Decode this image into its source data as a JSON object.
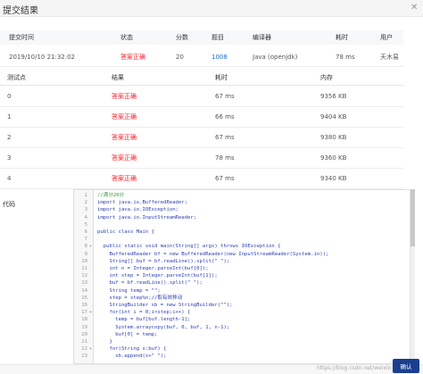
{
  "dialog": {
    "title": "提交结果",
    "close_symbol": "✕"
  },
  "summary": {
    "headers": [
      "提交时间",
      "状态",
      "分数",
      "题目",
      "编译器",
      "耗时",
      "用户"
    ],
    "row": {
      "time": "2019/10/10 21:32:02",
      "status": "答案正确",
      "score": "20",
      "problem": "1008",
      "compiler": "Java (openjdk)",
      "duration": "78 ms",
      "user": "天木易"
    }
  },
  "testcases": {
    "headers": [
      "测试点",
      "结果",
      "耗时",
      "内存"
    ],
    "rows": [
      {
        "id": "0",
        "result": "答案正确",
        "time": "67 ms",
        "memory": "9356 KB"
      },
      {
        "id": "1",
        "result": "答案正确",
        "time": "66 ms",
        "memory": "9404 KB"
      },
      {
        "id": "2",
        "result": "答案正确",
        "time": "67 ms",
        "memory": "9380 KB"
      },
      {
        "id": "3",
        "result": "答案正确",
        "time": "78 ms",
        "memory": "9360 KB"
      },
      {
        "id": "4",
        "result": "答案正确",
        "time": "67 ms",
        "memory": "9340 KB"
      }
    ]
  },
  "code_section": {
    "label": "代码",
    "lines": [
      {
        "n": "1",
        "fold": "",
        "text": "//满分20分"
      },
      {
        "n": "2",
        "fold": "",
        "text": "import java.io.BufferedReader;"
      },
      {
        "n": "3",
        "fold": "",
        "text": "import java.io.IOException;"
      },
      {
        "n": "4",
        "fold": "",
        "text": "import java.io.InputStreamReader;"
      },
      {
        "n": "5",
        "fold": "",
        "text": ""
      },
      {
        "n": "6",
        "fold": "",
        "text": "public class Main {"
      },
      {
        "n": "7",
        "fold": "",
        "text": ""
      },
      {
        "n": "8",
        "fold": "▾",
        "text": "  public static void main(String[] args) throws IOException {"
      },
      {
        "n": "9",
        "fold": "",
        "text": "    BufferedReader bf = new BufferedReader(new InputStreamReader(System.in));"
      },
      {
        "n": "10",
        "fold": "",
        "text": "    String[] buf = bf.readLine().split(\" \");"
      },
      {
        "n": "11",
        "fold": "",
        "text": "    int n = Integer.parseInt(buf[0]);"
      },
      {
        "n": "12",
        "fold": "",
        "text": "    int step = Integer.parseInt(buf[1]);"
      },
      {
        "n": "13",
        "fold": "",
        "text": "    buf = bf.readLine().split(\" \");"
      },
      {
        "n": "14",
        "fold": "",
        "text": "    String temp = \"\";"
      },
      {
        "n": "15",
        "fold": "",
        "text": "    step = step%n;//取有效移动"
      },
      {
        "n": "16",
        "fold": "",
        "text": "    StringBuilder sb = new StringBuilder(\"\");"
      },
      {
        "n": "17",
        "fold": "▾",
        "text": "    for(int i = 0;i<step;i++) {"
      },
      {
        "n": "18",
        "fold": "",
        "text": "      temp = buf[buf.length-1];"
      },
      {
        "n": "19",
        "fold": "",
        "text": "      System.arraycopy(buf, 0, buf, 1, n-1);"
      },
      {
        "n": "20",
        "fold": "",
        "text": "      buf[0] = temp;"
      },
      {
        "n": "21",
        "fold": "",
        "text": "    }"
      },
      {
        "n": "22",
        "fold": "▾",
        "text": "    for(String s:buf) {"
      },
      {
        "n": "23",
        "fold": "",
        "text": "      sb.append(s+\" \");"
      }
    ]
  },
  "footer": {
    "watermark": "https://blog.csdn.net/weixin_",
    "confirm_label": "确认"
  }
}
